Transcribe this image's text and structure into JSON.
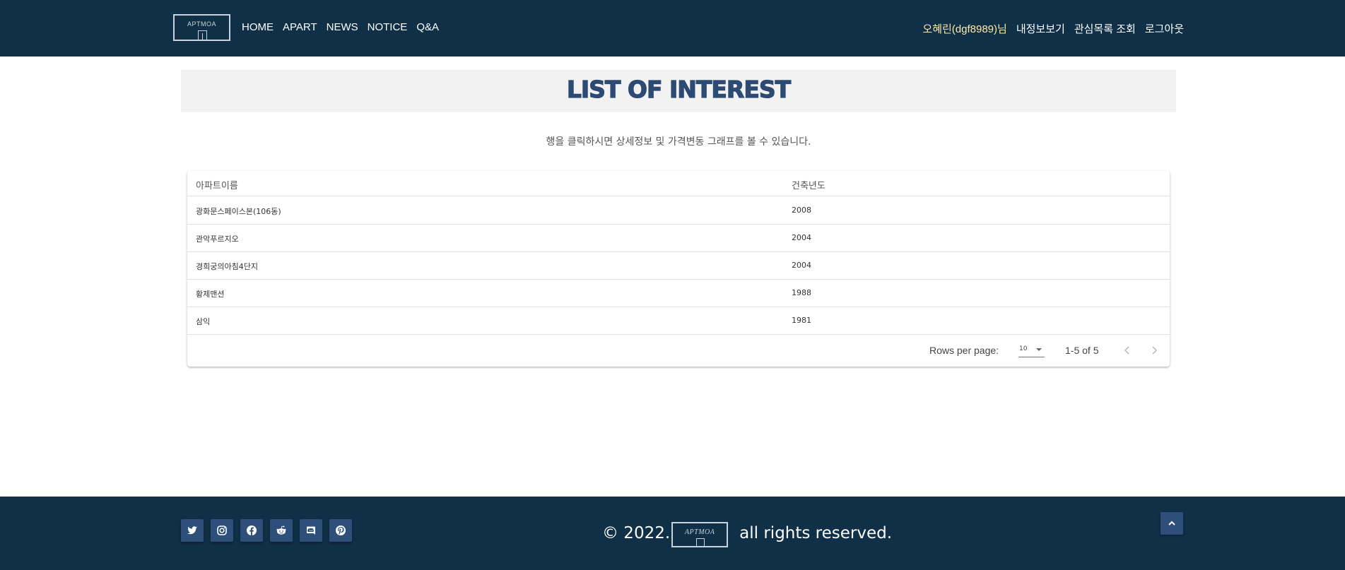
{
  "header": {
    "logo_text": "APTMOA",
    "nav": [
      "HOME",
      "APART",
      "NEWS",
      "NOTICE",
      "Q&A"
    ],
    "user_greeting": "오혜린(dgf8989)님",
    "user_links": [
      "내정보보기",
      "관심목록 조회",
      "로그아웃"
    ]
  },
  "banner": {
    "title": "LIST OF INTEREST"
  },
  "hint": "행을 클릭하시면 상세정보 및 가격변동 그래프를 볼 수 있습니다.",
  "table": {
    "columns": [
      "아파트이름",
      "건축년도"
    ],
    "rows": [
      [
        "광화문스페이스본(106동)",
        "2008"
      ],
      [
        "관악푸르지오",
        "2004"
      ],
      [
        "경희궁의아침4단지",
        "2004"
      ],
      [
        "황제맨션",
        "1988"
      ],
      [
        "삼익",
        "1981"
      ]
    ]
  },
  "pagination": {
    "rows_per_page_label": "Rows per page:",
    "rows_per_page_value": "10",
    "range": "1-5 of 5"
  },
  "footer": {
    "socials": [
      "twitter-icon",
      "instagram-icon",
      "facebook-icon",
      "reddit-icon",
      "discord-icon",
      "pinterest-icon"
    ],
    "copyright_left": "© 2022.",
    "copyright_logo": "APTMOA",
    "copyright_right": "all rights reserved."
  },
  "colors": {
    "header_bg": "#0f3047",
    "banner_bg": "#f2f2f2",
    "title_color": "#2c4a73",
    "greeting_color": "#ffe9a8",
    "button_bg": "#2e4f7a"
  }
}
